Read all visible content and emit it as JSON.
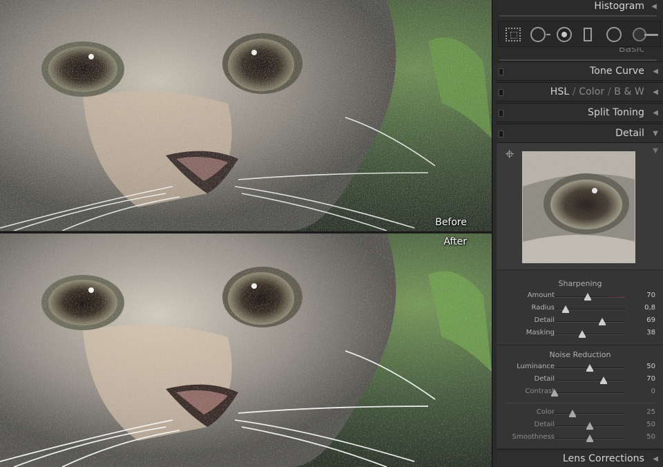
{
  "photo_panes": {
    "before_label": "Before",
    "after_label": "After"
  },
  "panel": {
    "histogram": {
      "title": "Histogram",
      "toggle_icon": "triangle-left-icon"
    },
    "tools": [
      {
        "name": "crop-overlay-icon"
      },
      {
        "name": "spot-removal-icon"
      },
      {
        "name": "red-eye-icon"
      },
      {
        "name": "graduated-filter-icon"
      },
      {
        "name": "radial-filter-icon"
      },
      {
        "name": "adjustment-brush-icon"
      }
    ],
    "sections": {
      "basic": "Basic",
      "tone_curve": "Tone Curve",
      "hsl": {
        "hsl": "HSL",
        "sep": "/",
        "color": "Color",
        "bw": "B & W"
      },
      "split_toning": "Split Toning",
      "detail": "Detail",
      "lens_corrections": "Lens Corrections"
    },
    "detail": {
      "sharpening": {
        "title": "Sharpening",
        "sliders": [
          {
            "label": "Amount",
            "value": "70",
            "fraction": 0.47
          },
          {
            "label": "Radius",
            "value": "0,8",
            "fraction": 0.16
          },
          {
            "label": "Detail",
            "value": "69",
            "fraction": 0.68
          },
          {
            "label": "Masking",
            "value": "38",
            "fraction": 0.39
          }
        ]
      },
      "noise_reduction": {
        "title": "Noise Reduction",
        "sliders": [
          {
            "label": "Luminance",
            "value": "50",
            "fraction": 0.5
          },
          {
            "label": "Detail",
            "value": "70",
            "fraction": 0.7
          },
          {
            "label": "Contrast",
            "value": "0",
            "fraction": 0.0
          },
          {
            "label": "Color",
            "value": "25",
            "fraction": 0.25
          },
          {
            "label": "Detail",
            "value": "50",
            "fraction": 0.5
          },
          {
            "label": "Smoothness",
            "value": "50",
            "fraction": 0.5
          }
        ]
      }
    }
  },
  "colors": {
    "panel_bg": "#2b2b2b",
    "section_bg": "#353535",
    "text": "#d4d4d4",
    "amount_track_accent": "#6a2a2a"
  }
}
